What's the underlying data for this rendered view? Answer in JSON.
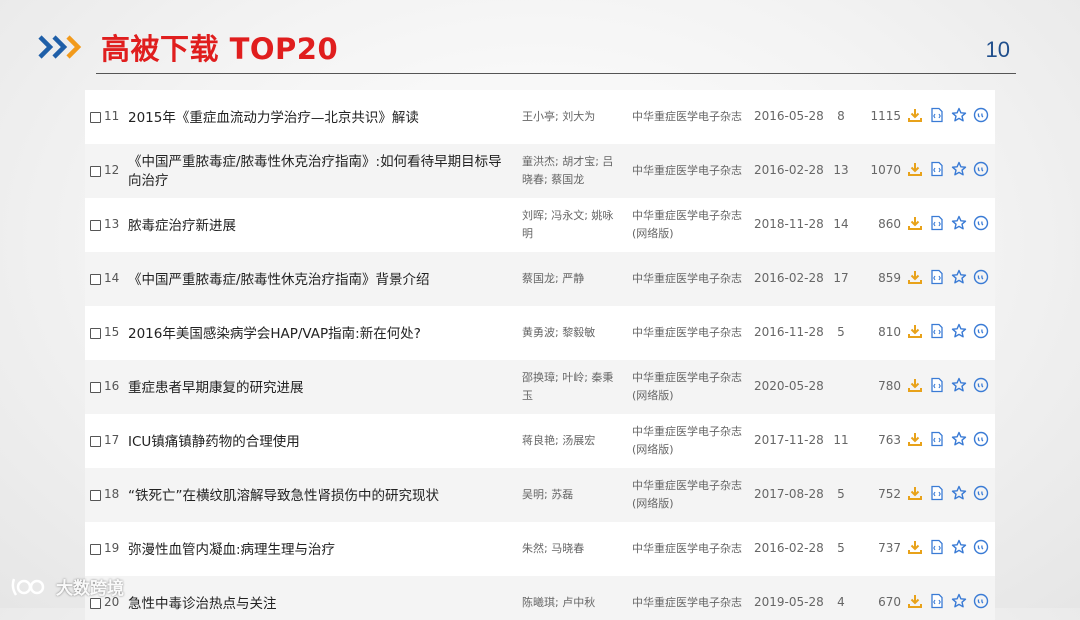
{
  "header": {
    "title": "高被下载 TOP20",
    "page_number": "10"
  },
  "rows": [
    {
      "index": "11",
      "title": "2015年《重症血流动力学治疗—北京共识》解读",
      "authors": "王小亭; 刘大为",
      "source": "中华重症医学电子杂志",
      "date": "2016-05-28",
      "citations": "8",
      "downloads": "1115"
    },
    {
      "index": "12",
      "title": "《中国严重脓毒症/脓毒性休克治疗指南》:如何看待早期目标导向治疗",
      "authors": "童洪杰; 胡才宝; 吕晓春; 蔡国龙",
      "source": "中华重症医学电子杂志",
      "date": "2016-02-28",
      "citations": "13",
      "downloads": "1070"
    },
    {
      "index": "13",
      "title": "脓毒症治疗新进展",
      "authors": "刘晖; 冯永文; 姚咏明",
      "source": "中华重症医学电子杂志(网络版)",
      "date": "2018-11-28",
      "citations": "14",
      "downloads": "860"
    },
    {
      "index": "14",
      "title": "《中国严重脓毒症/脓毒性休克治疗指南》背景介绍",
      "authors": "蔡国龙; 严静",
      "source": "中华重症医学电子杂志",
      "date": "2016-02-28",
      "citations": "17",
      "downloads": "859"
    },
    {
      "index": "15",
      "title": "2016年美国感染病学会HAP/VAP指南:新在何处?",
      "authors": "黄勇波; 黎毅敏",
      "source": "中华重症医学电子杂志",
      "date": "2016-11-28",
      "citations": "5",
      "downloads": "810"
    },
    {
      "index": "16",
      "title": "重症患者早期康复的研究进展",
      "authors": "邵换璋; 叶岭; 秦秉玉",
      "source": "中华重症医学电子杂志(网络版)",
      "date": "2020-05-28",
      "citations": "",
      "downloads": "780"
    },
    {
      "index": "17",
      "title": "ICU镇痛镇静药物的合理使用",
      "authors": "蒋良艳; 汤展宏",
      "source": "中华重症医学电子杂志(网络版)",
      "date": "2017-11-28",
      "citations": "11",
      "downloads": "763"
    },
    {
      "index": "18",
      "title": "“铁死亡”在横纹肌溶解导致急性肾损伤中的研究现状",
      "authors": "吴明; 苏磊",
      "source": "中华重症医学电子杂志(网络版)",
      "date": "2017-08-28",
      "citations": "5",
      "downloads": "752"
    },
    {
      "index": "19",
      "title": "弥漫性血管内凝血:病理生理与治疗",
      "authors": "朱然; 马晓春",
      "source": "中华重症医学电子杂志",
      "date": "2016-02-28",
      "citations": "5",
      "downloads": "737"
    },
    {
      "index": "20",
      "title": "急性中毒诊治热点与关注",
      "authors": "陈曦琪; 卢中秋",
      "source": "中华重症医学电子杂志",
      "date": "2019-05-28",
      "citations": "4",
      "downloads": "670"
    }
  ],
  "watermark": "大数跨境",
  "colors": {
    "title_red": "#e01e1e",
    "accent_blue": "#1f4e8c",
    "chevron_blue": "#1f5fa8",
    "chevron_orange": "#f29a1b",
    "download_orange": "#e8a21a",
    "icon_blue": "#3a7bd5"
  },
  "icons": [
    "download-icon",
    "html-icon",
    "favorite-star-icon",
    "cite-quote-icon"
  ]
}
